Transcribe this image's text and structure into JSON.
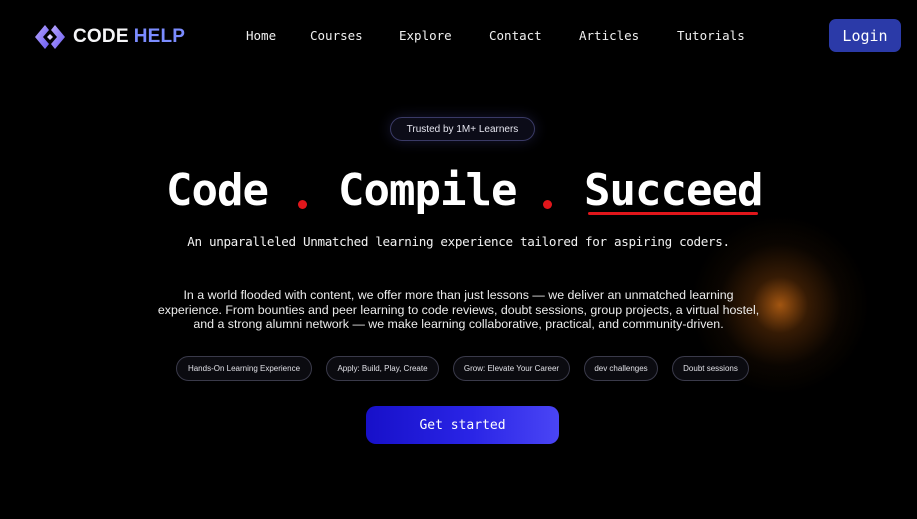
{
  "header": {
    "logo": {
      "icon": "code-help-logo-icon",
      "word1": "CODE",
      "word2": "HELP"
    },
    "nav": [
      "Home",
      "Courses",
      "Explore",
      "Contact",
      "Articles",
      "Tutorials"
    ],
    "login_label": "Login"
  },
  "hero": {
    "badge": "Trusted by 1M+ Learners",
    "headline": [
      "Code",
      "Compile",
      "Succeed"
    ],
    "tagline": "An unparalleled Unmatched learning experience tailored for aspiring coders.",
    "description": "In a world flooded with content, we offer more than just lessons — we deliver an unmatched learning experience. From bounties and peer learning to code reviews, doubt sessions, group projects, a virtual hostel, and a strong alumni network — we make learning collaborative, practical, and community-driven.",
    "chips": [
      "Hands-On Learning Experience",
      "Apply: Build, Play, Create",
      "Grow: Elevate Your Career",
      "dev challenges",
      "Doubt sessions"
    ],
    "cta_label": "Get started"
  },
  "colors": {
    "background": "#000000",
    "accent_red": "#e0161b",
    "brand_blue": "#7b8cff",
    "login_button": "#2b3aa8",
    "cta_gradient": [
      "#1710c9",
      "#4a45f5"
    ],
    "glow": "#be6414"
  }
}
